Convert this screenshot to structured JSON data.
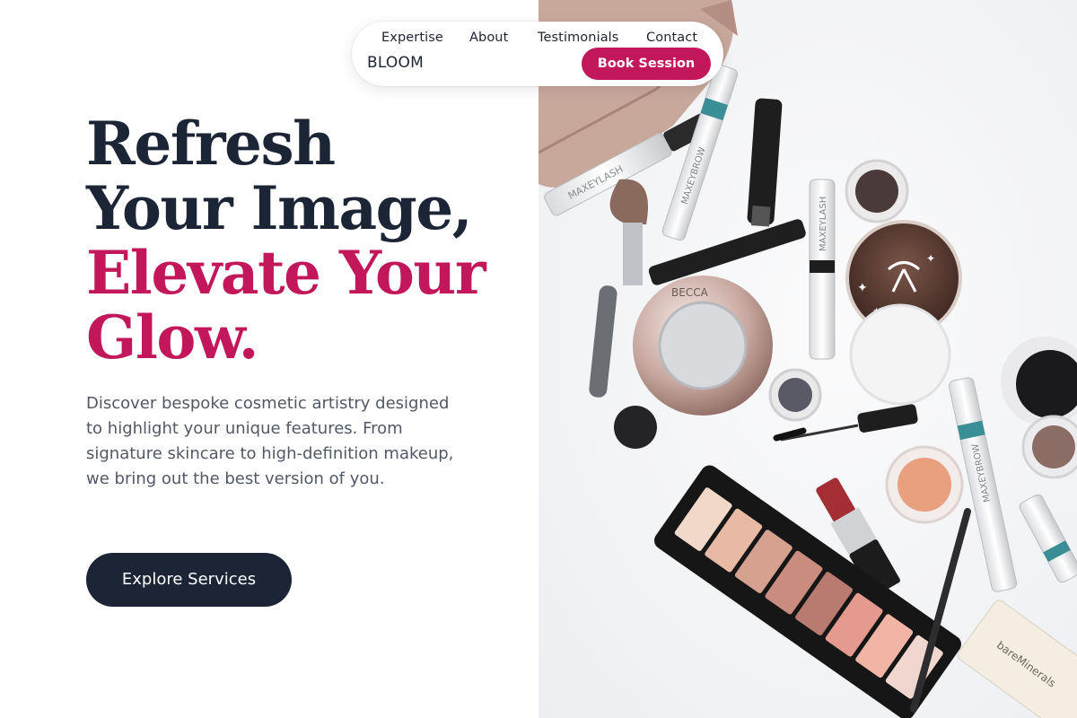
{
  "nav": {
    "links": [
      "Expertise",
      "About",
      "Testimonials",
      "Contact"
    ],
    "brand": "BLOOM",
    "cta_label": "Book Session"
  },
  "hero": {
    "headline_lines": [
      "Refresh",
      "Your Image,",
      "Elevate Your",
      "Glow."
    ],
    "lead": "Discover bespoke cosmetic artistry designed to highlight your unique features. From signature skincare to high-definition makeup, we bring out the best version of you.",
    "cta_label": "Explore Services"
  },
  "photo": {
    "product_labels": [
      "MAXEYLASH",
      "MAXEYBROW",
      "MAXEYLASH",
      "MAXEYBROW",
      "BECCA",
      "bareMinerals"
    ]
  },
  "colors": {
    "accent": "#c2185b",
    "navy": "#1c2536",
    "text_muted": "#515866"
  }
}
